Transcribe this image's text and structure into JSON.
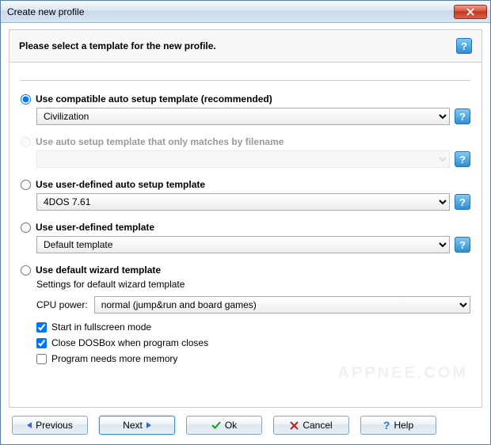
{
  "window": {
    "title": "Create new profile"
  },
  "header": {
    "prompt": "Please select a template for the new profile."
  },
  "options": {
    "compatible": {
      "label": "Use compatible auto setup template (recommended)",
      "select_value": "Civilization"
    },
    "filename": {
      "label": "Use auto setup template that only matches by filename",
      "select_value": ""
    },
    "user_auto": {
      "label": "Use user-defined auto setup template",
      "select_value": "4DOS 7.61"
    },
    "user_template": {
      "label": "Use user-defined template",
      "select_value": "Default template"
    },
    "default_wizard": {
      "label": "Use default wizard template",
      "settings_title": "Settings for default wizard template",
      "cpu_label": "CPU power:",
      "cpu_value": "normal (jump&run and board games)",
      "checks": {
        "fullscreen": {
          "label": "Start in fullscreen mode",
          "checked": true
        },
        "close_dosbox": {
          "label": "Close DOSBox when program closes",
          "checked": true
        },
        "more_memory": {
          "label": "Program needs more memory",
          "checked": false
        }
      }
    },
    "selected": "compatible"
  },
  "buttons": {
    "previous": "Previous",
    "next": "Next",
    "ok": "Ok",
    "cancel": "Cancel",
    "help": "Help"
  },
  "watermark": "APPNEE.COM",
  "help_glyph": "?"
}
